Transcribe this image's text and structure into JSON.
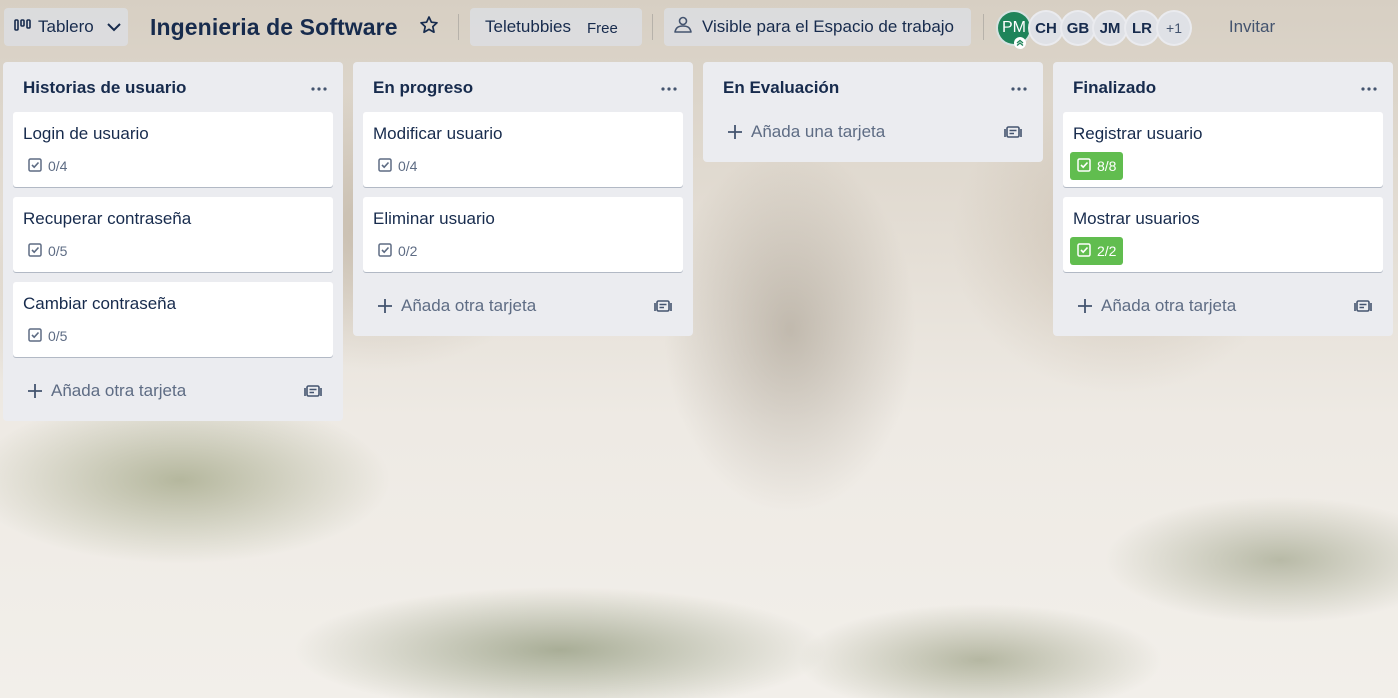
{
  "header": {
    "view_label": "Tablero",
    "board_title": "Ingenieria de Software",
    "workspace_name": "Teletubbies",
    "workspace_plan": "Free",
    "visibility_label": "Visible para el Espacio de trabajo",
    "members": [
      "PM",
      "CH",
      "GB",
      "JM",
      "LR"
    ],
    "members_more": "+1",
    "invite_label": "Invitar"
  },
  "lists": [
    {
      "title": "Historias de usuario",
      "cards": [
        {
          "title": "Login de usuario",
          "checklist": "0/4"
        },
        {
          "title": "Recuperar contraseña",
          "checklist": "0/5"
        },
        {
          "title": "Cambiar contraseña",
          "checklist": "0/5"
        }
      ],
      "add_label": "Añada otra tarjeta"
    },
    {
      "title": "En progreso",
      "cards": [
        {
          "title": "Modificar usuario",
          "checklist": "0/4"
        },
        {
          "title": "Eliminar usuario",
          "checklist": "0/2"
        }
      ],
      "add_label": "Añada otra tarjeta"
    },
    {
      "title": "En Evaluación",
      "cards": [],
      "add_label": "Añada una tarjeta"
    },
    {
      "title": "Finalizado",
      "cards": [
        {
          "title": "Registrar usuario",
          "checklist": "8/8"
        },
        {
          "title": "Mostrar usuarios",
          "checklist": "2/2"
        }
      ],
      "add_label": "Añada otra tarjeta"
    }
  ],
  "colors": {
    "list_bg": "#ebecf0",
    "text": "#172b4d",
    "muted": "#5e6c84",
    "checklist_complete": "#61bd4f",
    "avatar_owner": "#1f845a"
  }
}
